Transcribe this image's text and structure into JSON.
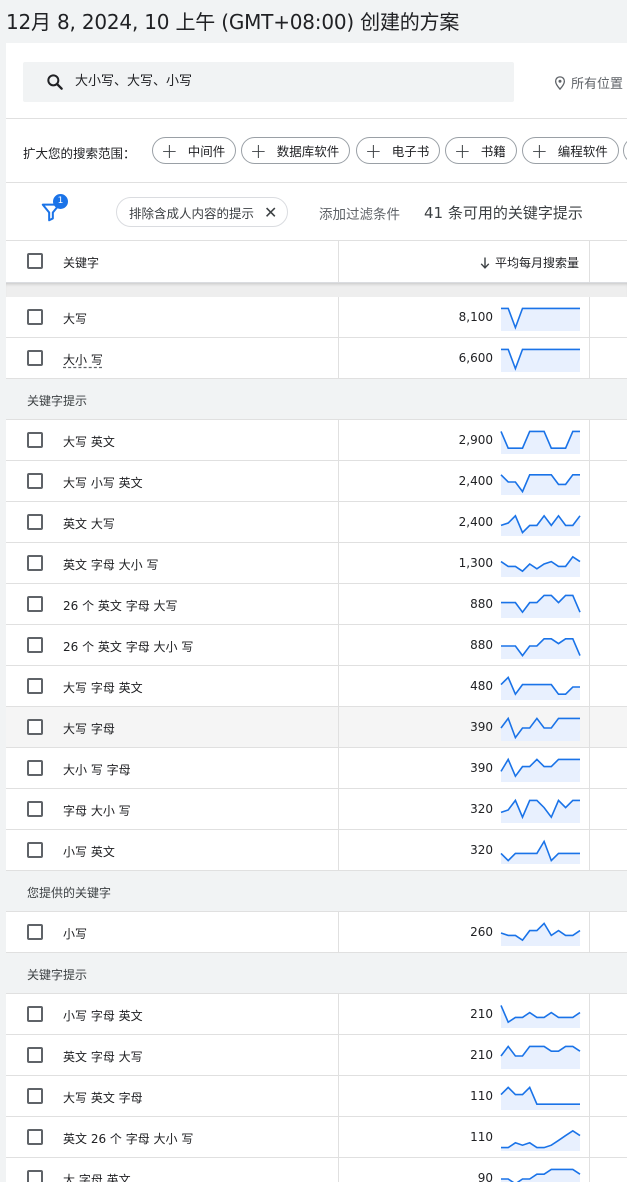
{
  "page": {
    "title": "12月 8, 2024, 10 上午 (GMT+08:00) 创建的方案"
  },
  "search": {
    "value": "大小写、大写、小写",
    "location": "所有位置"
  },
  "broaden": {
    "label": "扩大您的搜索范围：",
    "chips": [
      "中间件",
      "数据库软件",
      "电子书",
      "书籍",
      "编程软件"
    ]
  },
  "filters": {
    "badge": "1",
    "applied_chip": "排除含成人内容的提示",
    "add_filter": "添加过滤条件",
    "count_text": "41 条可用的关键字提示"
  },
  "table": {
    "col_keyword": "关键字",
    "col_volume": "平均每月搜索量",
    "accent": "#1a73e8"
  },
  "rows": [
    {
      "type": "kw",
      "keyword": "大写",
      "volume": "8,100",
      "trend": [
        9,
        9,
        1,
        9,
        9,
        9,
        9,
        9,
        9,
        9,
        9,
        9
      ],
      "dotted": false
    },
    {
      "type": "kw",
      "keyword": "大小 写",
      "volume": "6,600",
      "trend": [
        9,
        9,
        1,
        9,
        9,
        9,
        9,
        9,
        9,
        9,
        9,
        9
      ],
      "dotted": true
    },
    {
      "type": "group",
      "label": "关键字提示"
    },
    {
      "type": "kw",
      "keyword": "大写 英文",
      "volume": "2,900",
      "trend": [
        9,
        2,
        2,
        2,
        9,
        9,
        9,
        2,
        2,
        2,
        9,
        9
      ],
      "dotted": false
    },
    {
      "type": "kw",
      "keyword": "大写 小写 英文",
      "volume": "2,400",
      "trend": [
        8,
        5,
        5,
        1,
        8,
        8,
        8,
        8,
        4,
        4,
        8,
        8
      ],
      "dotted": false
    },
    {
      "type": "kw",
      "keyword": "英文 大写",
      "volume": "2,400",
      "trend": [
        4,
        5,
        8,
        1,
        4,
        4,
        8,
        4,
        8,
        4,
        4,
        8
      ],
      "dotted": false
    },
    {
      "type": "kw",
      "keyword": "英文 字母 大小 写",
      "volume": "1,300",
      "trend": [
        6,
        4,
        4,
        2,
        5,
        3,
        5,
        6,
        4,
        4,
        8,
        6
      ],
      "dotted": false
    },
    {
      "type": "kw",
      "keyword": "26 个 英文 字母 大写",
      "volume": "880",
      "trend": [
        6,
        6,
        6,
        2,
        6,
        6,
        9,
        9,
        6,
        9,
        9,
        2
      ],
      "dotted": false
    },
    {
      "type": "kw",
      "keyword": "26 个 英文 字母 大小 写",
      "volume": "880",
      "trend": [
        5,
        5,
        5,
        1,
        5,
        5,
        8,
        8,
        6,
        8,
        8,
        1
      ],
      "dotted": false
    },
    {
      "type": "kw",
      "keyword": "大写 字母 英文",
      "volume": "480",
      "trend": [
        6,
        9,
        2,
        6,
        6,
        6,
        6,
        6,
        2,
        2,
        5,
        5
      ],
      "dotted": false
    },
    {
      "type": "kw",
      "keyword": "大写 字母",
      "volume": "390",
      "trend": [
        5,
        9,
        1,
        5,
        5,
        9,
        5,
        5,
        9,
        9,
        9,
        9
      ],
      "dotted": false,
      "highlight": true
    },
    {
      "type": "kw",
      "keyword": "大小 写 字母",
      "volume": "390",
      "trend": [
        4,
        9,
        2,
        6,
        6,
        9,
        6,
        6,
        9,
        9,
        9,
        9
      ],
      "dotted": false
    },
    {
      "type": "kw",
      "keyword": "字母 大小 写",
      "volume": "320",
      "trend": [
        4,
        5,
        9,
        2,
        9,
        9,
        6,
        2,
        9,
        6,
        9,
        9
      ],
      "dotted": false
    },
    {
      "type": "kw",
      "keyword": "小写 英文",
      "volume": "320",
      "trend": [
        4,
        1,
        4,
        4,
        4,
        4,
        9,
        1,
        4,
        4,
        4,
        4
      ],
      "dotted": false
    },
    {
      "type": "group",
      "label": "您提供的关键字"
    },
    {
      "type": "kw",
      "keyword": "小写",
      "volume": "260",
      "trend": [
        5,
        4,
        4,
        2,
        6,
        6,
        9,
        4,
        6,
        4,
        4,
        6
      ],
      "dotted": false
    },
    {
      "type": "group",
      "label": "关键字提示"
    },
    {
      "type": "kw",
      "keyword": "小写 字母 英文",
      "volume": "210",
      "trend": [
        9,
        2,
        4,
        4,
        6,
        4,
        4,
        6,
        4,
        4,
        4,
        6
      ],
      "dotted": false
    },
    {
      "type": "kw",
      "keyword": "英文 字母 大写",
      "volume": "210",
      "trend": [
        5,
        9,
        5,
        5,
        9,
        9,
        9,
        7,
        7,
        9,
        9,
        7
      ],
      "dotted": false
    },
    {
      "type": "kw",
      "keyword": "大写 英文 字母",
      "volume": "110",
      "trend": [
        6,
        9,
        6,
        6,
        9,
        2,
        2,
        2,
        2,
        2,
        2,
        2
      ],
      "dotted": false
    },
    {
      "type": "kw",
      "keyword": "英文 26 个 字母 大小 写",
      "volume": "110",
      "trend": [
        1,
        1,
        3,
        2,
        3,
        1,
        1,
        2,
        4,
        6,
        8,
        6
      ],
      "dotted": false
    },
    {
      "type": "kw",
      "keyword": "大 字母 英文",
      "volume": "90",
      "trend": [
        5,
        5,
        3,
        5,
        5,
        7,
        7,
        9,
        9,
        9,
        9,
        7
      ],
      "dotted": false
    }
  ]
}
